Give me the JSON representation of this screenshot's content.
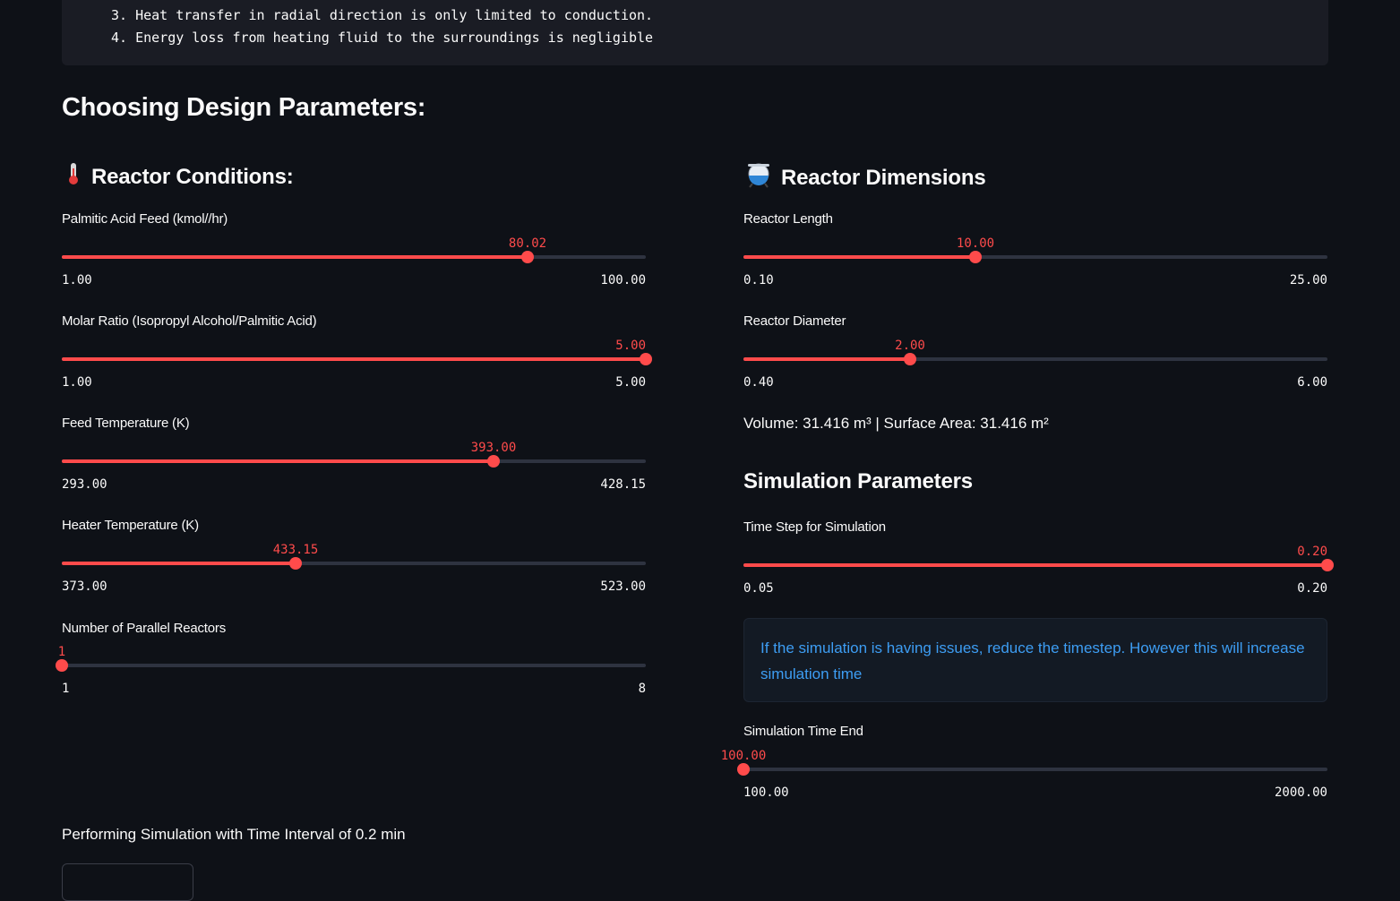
{
  "assumptions": [
    "3. Heat transfer in radial direction is only limited to conduction.",
    "4. Energy loss from heating fluid to the surroundings is negligible"
  ],
  "section_title": "Choosing Design Parameters:",
  "reactor_conditions": {
    "title": "Reactor Conditions:",
    "icon": "thermometer-icon",
    "sliders": [
      {
        "label": "Palmitic Acid Feed (kmol//hr)",
        "value": "80.02",
        "min": "1.00",
        "max": "100.00",
        "fraction": 0.798
      },
      {
        "label": "Molar Ratio (Isopropyl Alcohol/Palmitic Acid)",
        "value": "5.00",
        "min": "1.00",
        "max": "5.00",
        "fraction": 1.0
      },
      {
        "label": "Feed Temperature (K)",
        "value": "393.00",
        "min": "293.00",
        "max": "428.15",
        "fraction": 0.74
      },
      {
        "label": "Heater Temperature (K)",
        "value": "433.15",
        "min": "373.00",
        "max": "523.00",
        "fraction": 0.401
      },
      {
        "label": "Number of Parallel Reactors",
        "value": "1",
        "min": "1",
        "max": "8",
        "fraction": 0.0
      }
    ]
  },
  "reactor_dimensions": {
    "title": "Reactor Dimensions",
    "icon": "flask-icon",
    "sliders": [
      {
        "label": "Reactor Length",
        "value": "10.00",
        "min": "0.10",
        "max": "25.00",
        "fraction": 0.398
      },
      {
        "label": "Reactor Diameter",
        "value": "2.00",
        "min": "0.40",
        "max": "6.00",
        "fraction": 0.286
      }
    ],
    "summary": "Volume: 31.416 m³ | Surface Area: 31.416 m²"
  },
  "simulation": {
    "title": "Simulation Parameters",
    "time_step": {
      "label": "Time Step for Simulation",
      "value": "0.20",
      "min": "0.05",
      "max": "0.20",
      "fraction": 1.0
    },
    "info": "If the simulation is having issues, reduce the timestep. However this will increase simulation time",
    "time_end": {
      "label": "Simulation Time End",
      "value": "100.00",
      "min": "100.00",
      "max": "2000.00",
      "fraction": 0.0
    }
  },
  "status_text": "Performing Simulation with Time Interval of 0.2 min"
}
